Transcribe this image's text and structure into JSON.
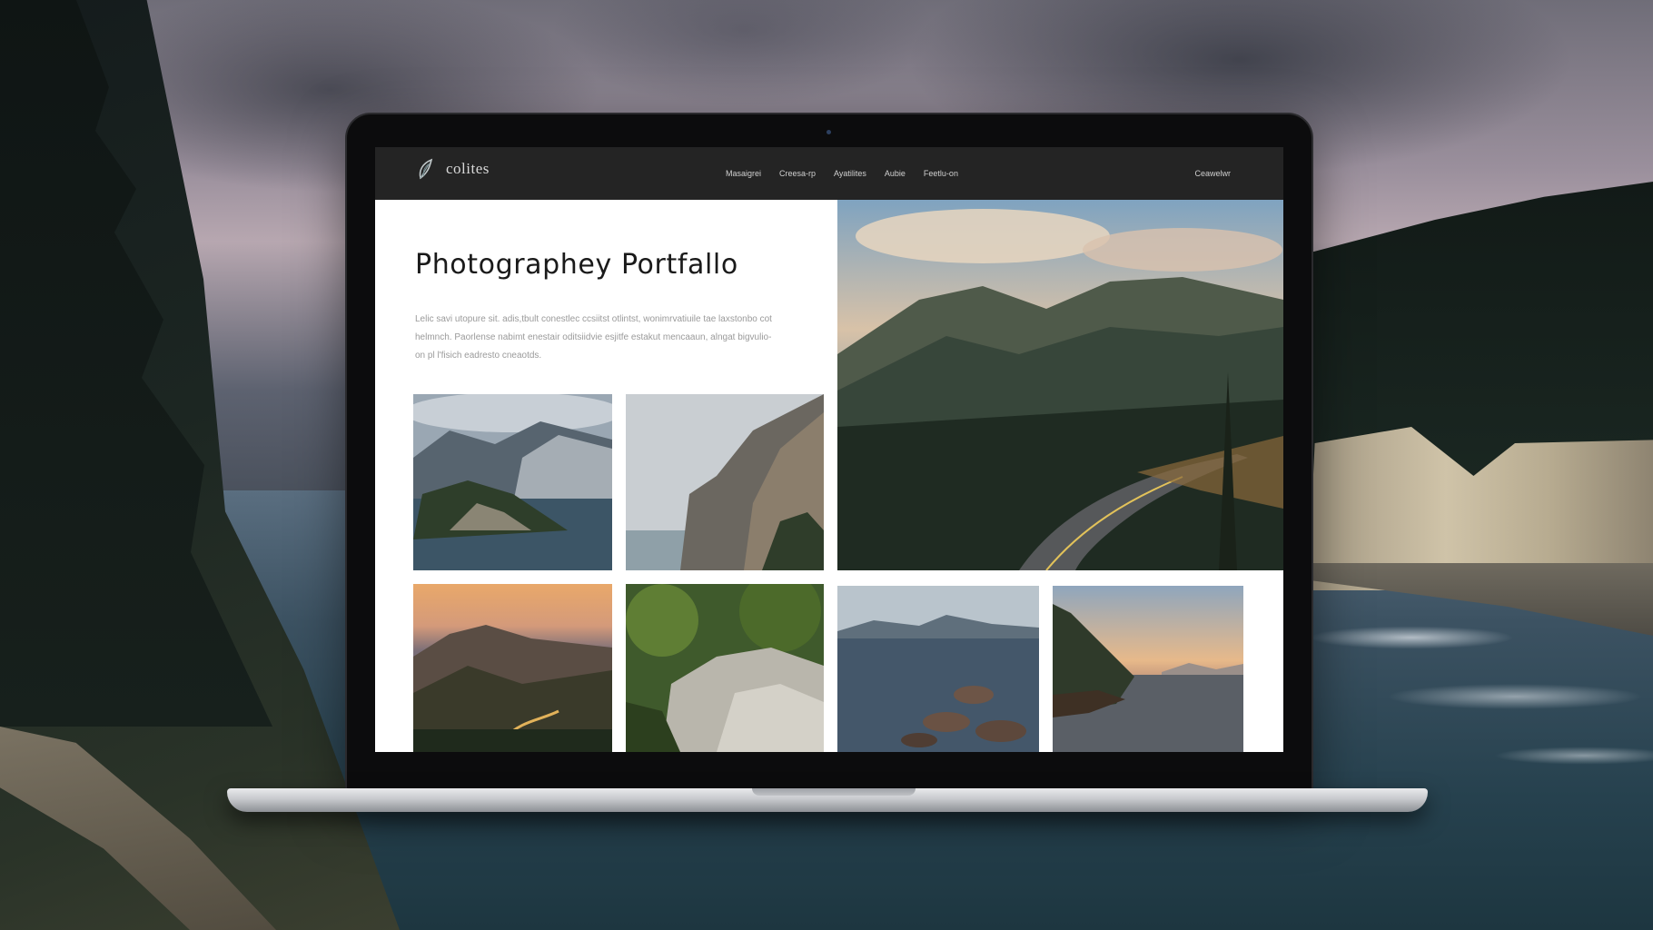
{
  "site": {
    "brand_name": "colites",
    "nav": [
      "Masaigrei",
      "Creesa-rp",
      "Ayatilites",
      "Aubie",
      "Feetlu-on"
    ],
    "nav_right": "Ceawelwr"
  },
  "hero": {
    "title": "Photographey Portfallo",
    "text": "Lelic savi utopure sit. adis,tbult conestlec ccsiitst otlintst, wonimrvatiuile tae laxstonbo cot helmnch. Paorlense nabimt enestair oditsiidvie esjitfe estakut mencaaun, alngat bigvulio-on pl l'fisich eadresto cneaotds."
  },
  "gallery": [
    {
      "id": "hero-road",
      "icon": "mountain-road-photo"
    },
    {
      "id": "lake-island",
      "icon": "lake-island-photo"
    },
    {
      "id": "sea-cliff",
      "icon": "sea-cliff-photo"
    },
    {
      "id": "sunset-valley",
      "icon": "sunset-valley-photo"
    },
    {
      "id": "mossy-rocks",
      "icon": "mossy-rocks-photo"
    },
    {
      "id": "rocky-shore",
      "icon": "rocky-shore-photo"
    },
    {
      "id": "fjord-dusk",
      "icon": "fjord-dusk-photo"
    }
  ],
  "colors": {
    "nav_bg": "#242424",
    "page_bg": "#ffffff",
    "title": "#1a1a1a",
    "body_text": "#9a9a9a"
  }
}
